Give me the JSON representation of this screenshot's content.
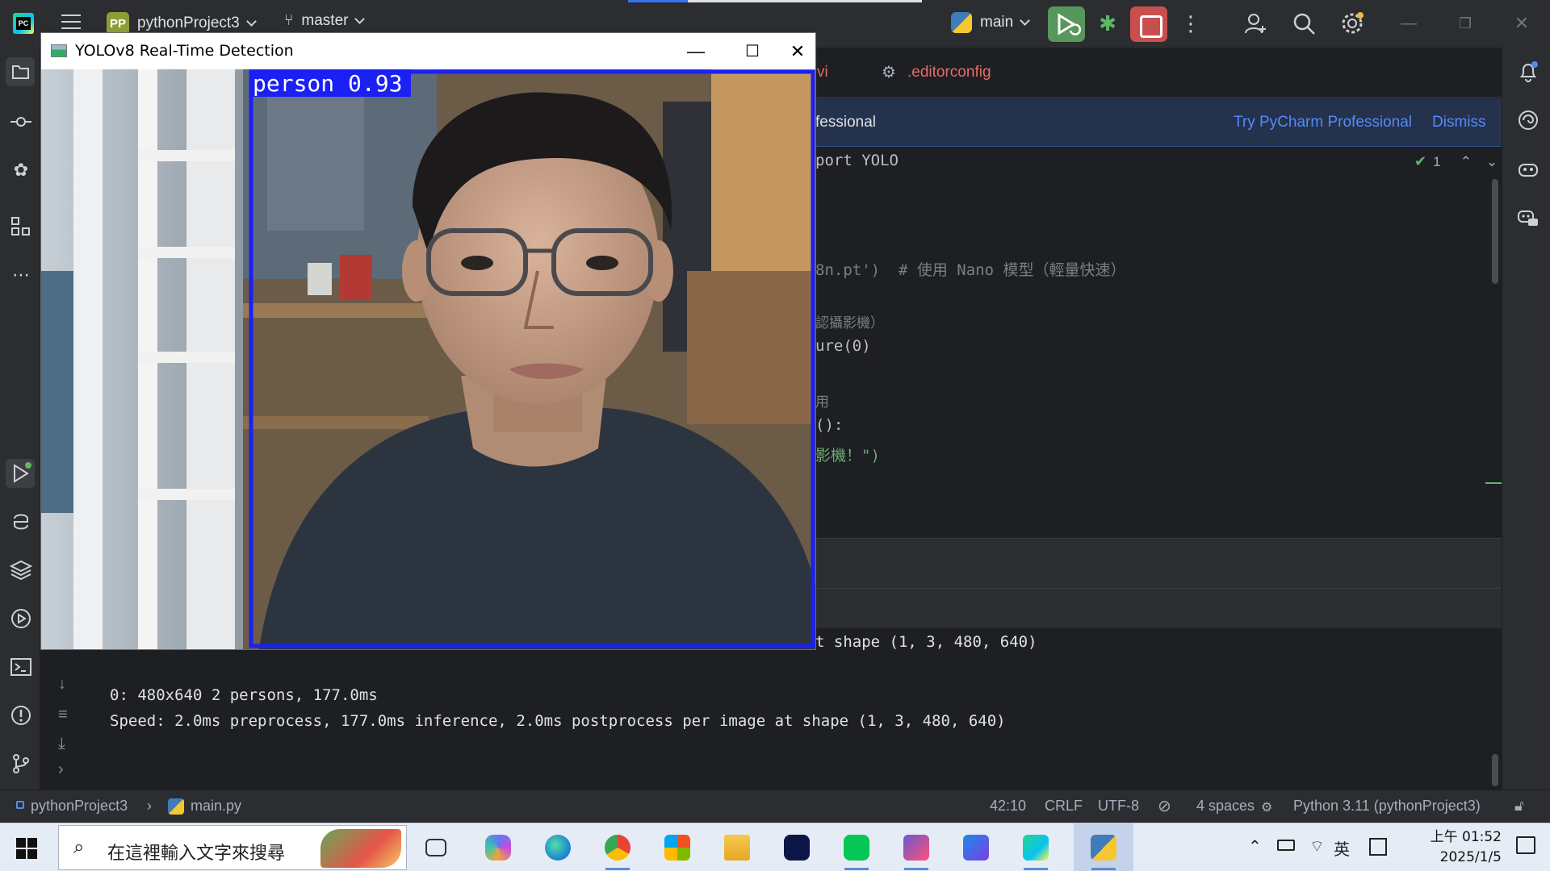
{
  "ide": {
    "project_badge": "PP",
    "project_name": "pythonProject3",
    "vcs_branch": "master",
    "run_config": "main",
    "editor_tab": ".editorconfig",
    "editor_tab_partial": "vi",
    "banner": {
      "partial_text": "fessional",
      "try_link": "Try PyCharm Professional",
      "dismiss": "Dismiss"
    },
    "inspection_count": "1",
    "code_lines": [
      {
        "t": "port YOLO",
        "c": "#bcbec4"
      },
      {
        "t": "8n.pt')  # 使用 Nano 模型（輕量快速）",
        "c": "#7a7e85"
      },
      {
        "t": "認攝影機）",
        "c": "#7a7e85"
      },
      {
        "t": "ure(0)",
        "c": "#bcbec4"
      },
      {
        "t": "用",
        "c": "#7a7e85"
      },
      {
        "t": "():",
        "c": "#bcbec4"
      },
      {
        "t": "影機！\")",
        "c": "#6aab73"
      }
    ],
    "console": {
      "line_top_partial": "t shape (1, 3, 480, 640)",
      "line1": "0: 480x640 2 persons, 177.0ms",
      "line2": "Speed: 2.0ms preprocess, 177.0ms inference, 2.0ms postprocess per image at shape (1, 3, 480, 640)"
    },
    "status": {
      "breadcrumb_project": "pythonProject3",
      "breadcrumb_file": "main.py",
      "position": "42:10",
      "line_sep": "CRLF",
      "encoding": "UTF-8",
      "indent": "4 spaces",
      "interpreter": "Python 3.11 (pythonProject3)"
    }
  },
  "cv_window": {
    "title": "YOLOv8 Real-Time Detection",
    "detection_label": "person 0.93",
    "box_color": "#1b20f5"
  },
  "taskbar": {
    "search_placeholder": "在這裡輸入文字來搜尋",
    "tray_ime": "英",
    "time": "上午 01:52",
    "date": "2025/1/5"
  },
  "colors": {
    "ide_bg": "#1e1f22",
    "ide_panel": "#2b2d30",
    "run_green": "#57965c",
    "stop_red": "#c94f4f",
    "accent_blue": "#548af7"
  }
}
